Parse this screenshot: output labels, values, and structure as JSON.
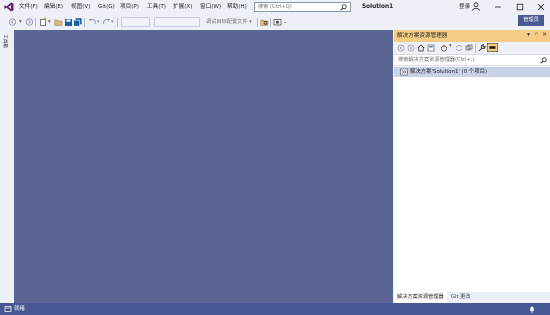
{
  "menu": {
    "items": [
      "文件(F)",
      "编辑(E)",
      "视图(V)",
      "Git(G)",
      "项目(P)",
      "工具(T)",
      "扩展(X)",
      "窗口(W)",
      "帮助(H)"
    ]
  },
  "search": {
    "placeholder": "搜索 (Ctrl+Q)"
  },
  "solution_name": "Solution1",
  "account": {
    "login_label": "登录"
  },
  "toolbar": {
    "startup_config_label": "调试目标配置文件 ▾"
  },
  "admin_badge": "管理员",
  "left_strip": {
    "tab_label": "工具箱"
  },
  "solution_explorer": {
    "title": "解决方案资源管理器",
    "header_controls": [
      "▾",
      "ᵖ",
      "✕"
    ],
    "search_placeholder": "搜索解决方案资源管理器(Ctrl+;)",
    "tree_root": "解决方案'Solution1' (0 个项目)",
    "tabs": [
      "解决方案资源管理器",
      "Git 更改"
    ]
  },
  "status": {
    "text": "就绪"
  },
  "colors": {
    "accent": "#68217a",
    "editor_bg": "#5b6594",
    "status_bar": "#485894",
    "panel_header": "#f5cc84",
    "admin_badge": "#495a93"
  },
  "icons": [
    "vs-logo-icon",
    "search-icon",
    "user-icon",
    "minimize-icon",
    "maximize-icon",
    "close-icon",
    "back-icon",
    "forward-icon",
    "new-item-icon",
    "open-icon",
    "save-icon",
    "save-all-icon",
    "undo-icon",
    "redo-icon",
    "share-icon",
    "home-icon",
    "sync-icon",
    "wrench-icon",
    "preview-icon",
    "solution-icon",
    "notification-bell-icon",
    "status-ready-icon"
  ]
}
